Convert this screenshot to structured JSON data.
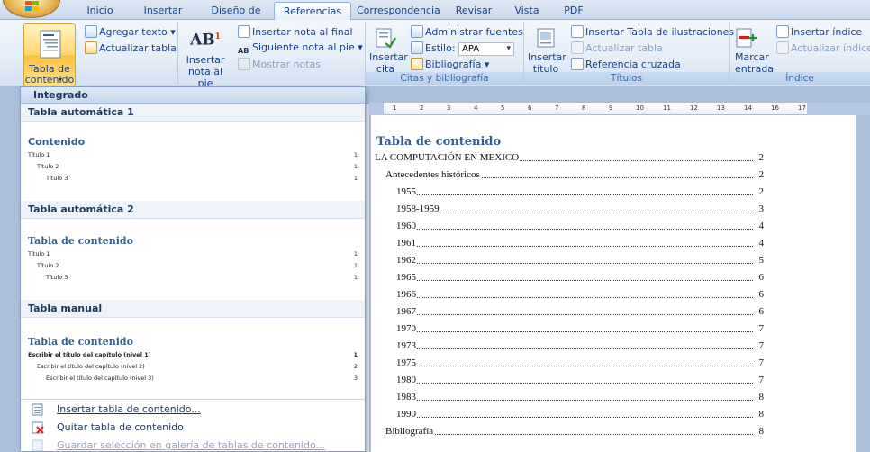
{
  "tabs": [
    "Inicio",
    "Insertar",
    "Diseño de página",
    "Referencias",
    "Correspondencia",
    "Revisar",
    "Vista",
    "PDF"
  ],
  "active_tab": "Referencias",
  "ribbon": {
    "toc_group": {
      "toc_button": "Tabla de contenido",
      "add_text": "Agregar texto",
      "update_table": "Actualizar tabla"
    },
    "footnotes_group": {
      "insert_footnote": "Insertar nota al pie",
      "insert_endnote": "Insertar nota al final",
      "next_footnote": "Siguiente nota al pie",
      "show_notes": "Mostrar notas"
    },
    "citations_group": {
      "insert_citation": "Insertar cita",
      "manage_sources": "Administrar fuentes",
      "style_label": "Estilo:",
      "style_value": "APA",
      "bibliography": "Bibliografía",
      "label": "Citas y bibliografía"
    },
    "captions_group": {
      "insert_caption": "Insertar título",
      "insert_table_figures": "Insertar Tabla de ilustraciones",
      "update_table": "Actualizar tabla",
      "cross_reference": "Referencia cruzada",
      "label": "Títulos"
    },
    "index_group": {
      "mark_entry": "Marcar entrada",
      "insert_index": "Insertar índice",
      "update_index": "Actualizar índice",
      "label": "Índice"
    }
  },
  "gallery": {
    "header": "Integrado",
    "sections": [
      {
        "name": "Tabla automática 1",
        "title": "Contenido",
        "lines": [
          {
            "text": "Título 1",
            "page": "1"
          },
          {
            "text": "Título 2",
            "page": "1"
          },
          {
            "text": "Título 3",
            "page": "1"
          }
        ]
      },
      {
        "name": "Tabla automática 2",
        "title": "Tabla de contenido",
        "lines": [
          {
            "text": "Título 1",
            "page": "1"
          },
          {
            "text": "Título 2",
            "page": "1"
          },
          {
            "text": "Título 3",
            "page": "1"
          }
        ]
      },
      {
        "name": "Tabla manual",
        "title": "Tabla de contenido",
        "lines": [
          {
            "text": "Escribir el título del capítulo (nivel 1)",
            "page": "1"
          },
          {
            "text": "Escribir el título del capítulo (nivel 2)",
            "page": "2"
          },
          {
            "text": "Escribir el título del capítulo (nivel 3)",
            "page": "3"
          }
        ]
      }
    ],
    "commands": [
      {
        "label": "Insertar tabla de contenido...",
        "enabled": true
      },
      {
        "label": "Quitar tabla de contenido",
        "enabled": true
      },
      {
        "label": "Guardar selección en galería de tablas de contenido...",
        "enabled": false
      }
    ]
  },
  "ruler": [
    "1",
    "2",
    "3",
    "4",
    "5",
    "6",
    "7",
    "8",
    "9",
    "10",
    "11",
    "12",
    "13",
    "14",
    "16",
    "17"
  ],
  "document": {
    "title": "Tabla de contenido",
    "entries": [
      {
        "text": "LA COMPUTACIÓN EN MEXICO",
        "page": "2",
        "level": 1
      },
      {
        "text": "Antecedentes históricos",
        "page": "2",
        "level": 2
      },
      {
        "text": "1955",
        "page": "2",
        "level": 3
      },
      {
        "text": "1958-1959",
        "page": "3",
        "level": 3
      },
      {
        "text": "1960",
        "page": "4",
        "level": 3
      },
      {
        "text": "1961",
        "page": "4",
        "level": 3
      },
      {
        "text": "1962",
        "page": "5",
        "level": 3
      },
      {
        "text": "1965",
        "page": "6",
        "level": 3
      },
      {
        "text": "1966",
        "page": "6",
        "level": 3
      },
      {
        "text": "1967",
        "page": "6",
        "level": 3
      },
      {
        "text": "1970",
        "page": "7",
        "level": 3
      },
      {
        "text": "1973",
        "page": "7",
        "level": 3
      },
      {
        "text": "1975",
        "page": "7",
        "level": 3
      },
      {
        "text": "1980",
        "page": "7",
        "level": 3
      },
      {
        "text": "1983",
        "page": "8",
        "level": 3
      },
      {
        "text": "1990",
        "page": "8",
        "level": 3
      },
      {
        "text": "Bibliografía",
        "page": "8",
        "level": 2
      }
    ]
  },
  "colors": {
    "ribbon_text": "#15428b",
    "toc_button_highlight": "#ffc23b",
    "heading_blue": "#365f91"
  }
}
